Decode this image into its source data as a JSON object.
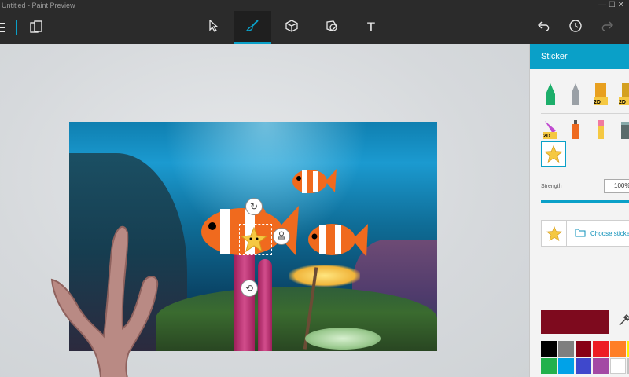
{
  "window": {
    "title": "Untitled - Paint Preview",
    "controls": "—  ☐  ✕"
  },
  "toolbar": {
    "tools": [
      {
        "name": "select",
        "icon": "cursor-icon"
      },
      {
        "name": "brushes",
        "icon": "brush-icon",
        "active": true
      },
      {
        "name": "3d-objects",
        "icon": "cube-icon"
      },
      {
        "name": "stickers",
        "icon": "sticker-icon"
      },
      {
        "name": "text",
        "icon": "text-icon",
        "glyph": "T"
      }
    ],
    "actions": [
      "undo-icon",
      "history-icon",
      "redo-icon"
    ]
  },
  "panel": {
    "title": "Sticker",
    "strength_label": "Strength",
    "strength_value": "100%",
    "choose_sticker_label": "Choose sticker",
    "selected_color": "#7e0a1e",
    "palette": [
      "#000000",
      "#7f7f7f",
      "#880015",
      "#ed1c24",
      "#ff7f27",
      "#fff200",
      "#22b14c",
      "#00a2e8",
      "#3f48cc",
      "#a349a4",
      "#ffffff",
      "#c3c3c3"
    ],
    "brush_labels": [
      "2D",
      "2D",
      "2D"
    ]
  },
  "colors": {
    "accent": "#0aa0c8",
    "toolbar": "#2b2b2b",
    "panel": "#f3f3f3"
  }
}
